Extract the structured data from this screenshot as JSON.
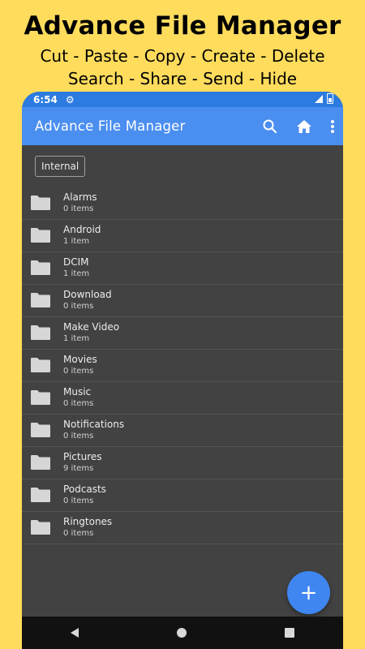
{
  "promo": {
    "title": "Advance File Manager",
    "line1": "Cut - Paste - Copy - Create - Delete",
    "line2": "Search - Share - Send - Hide"
  },
  "status_bar": {
    "time": "6:54"
  },
  "app_bar": {
    "title": "Advance File Manager"
  },
  "storage_chip": "Internal",
  "folders": [
    {
      "name": "Alarms",
      "count": "0 items"
    },
    {
      "name": "Android",
      "count": "1 item"
    },
    {
      "name": "DCIM",
      "count": "1 item"
    },
    {
      "name": "Download",
      "count": "0 items"
    },
    {
      "name": "Make Video",
      "count": "1 item"
    },
    {
      "name": "Movies",
      "count": "0 items"
    },
    {
      "name": "Music",
      "count": "0 items"
    },
    {
      "name": "Notifications",
      "count": "0 items"
    },
    {
      "name": "Pictures",
      "count": "9 items"
    },
    {
      "name": "Podcasts",
      "count": "0 items"
    },
    {
      "name": "Ringtones",
      "count": "0 items"
    }
  ],
  "fab_label": "+",
  "colors": {
    "background": "#FFDC5C",
    "app_bar": "#4a8ef0",
    "status_bar": "#2b7be0",
    "list_bg": "#424242",
    "fab": "#3f86f0"
  }
}
